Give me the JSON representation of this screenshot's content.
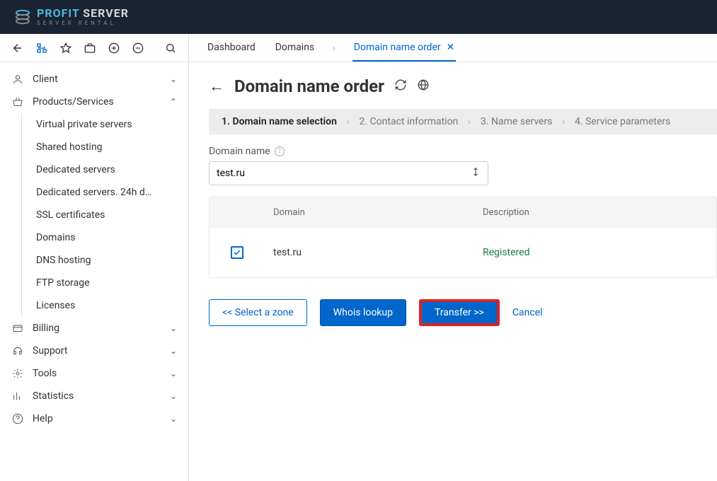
{
  "brand": {
    "line1a": "PROFIT",
    "line1b": " SERVER",
    "line2": "SERVER RENTAL"
  },
  "tabs": {
    "dashboard": "Dashboard",
    "domains": "Domains",
    "order": "Domain name order"
  },
  "sidebar": {
    "client": "Client",
    "products": "Products/Services",
    "products_items": [
      "Virtual private servers",
      "Shared hosting",
      "Dedicated servers",
      "Dedicated servers. 24h d…",
      "SSL certificates",
      "Domains",
      "DNS hosting",
      "FTP storage",
      "Licenses"
    ],
    "billing": "Billing",
    "support": "Support",
    "tools": "Tools",
    "statistics": "Statistics",
    "help": "Help"
  },
  "page": {
    "title": "Domain name order"
  },
  "steps": {
    "s1": "1. Domain name selection",
    "s2": "2. Contact information",
    "s3": "3. Name servers",
    "s4": "4. Service parameters"
  },
  "field": {
    "label": "Domain name",
    "value": "test.ru"
  },
  "table": {
    "col_domain": "Domain",
    "col_desc": "Description",
    "row_domain": "test.ru",
    "row_status": "Registered"
  },
  "buttons": {
    "select_zone": "<< Select a zone",
    "whois": "Whois lookup",
    "transfer": "Transfer >>",
    "cancel": "Cancel"
  }
}
